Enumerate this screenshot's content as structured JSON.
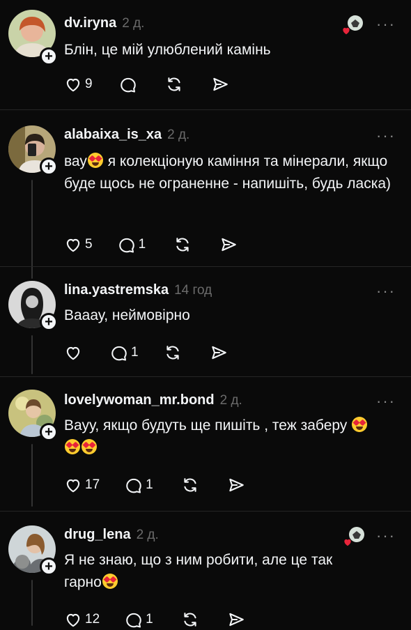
{
  "icons": {
    "like": "heart-outline-icon",
    "reply": "speech-bubble-icon",
    "repost": "repost-arrows-icon",
    "share": "send-arrow-icon",
    "more": "more-horizontal-icon",
    "follow": "plus-icon",
    "author_like": "author-reaction-icon"
  },
  "colors": {
    "background": "#0a0a0a",
    "text": "#f3f5f7",
    "muted": "#6b6b6b",
    "heart": "#e8243a"
  },
  "more_label": "···",
  "follow_label": "+",
  "posts": [
    {
      "username": "dv.iryna",
      "time": "2 д.",
      "text": "Блін, це мій улюблений камінь",
      "likes": "9",
      "replies": "",
      "author_liked": true
    },
    {
      "username": "alabaixa_is_xa",
      "time": "2 д.",
      "text_parts": [
        "вау",
        " я колекціоную каміння та мінерали, якщо буде щось не ограненне - напишіть, будь ласка)"
      ],
      "likes": "5",
      "replies": "1",
      "author_liked": false
    },
    {
      "username": "lina.yastremska",
      "time": "14 год",
      "text": "Вааау, неймовірно",
      "likes": "",
      "replies": "1",
      "author_liked": false
    },
    {
      "username": "lovelywoman_mr.bond",
      "time": "2 д.",
      "text_parts": [
        "Вауу, якщо будуть ще пишіть , теж заберу "
      ],
      "likes": "17",
      "replies": "1",
      "author_liked": false
    },
    {
      "username": "drug_lena",
      "time": "2 д.",
      "text_parts": [
        "Я не знаю, що з ним робити, але це так гарно"
      ],
      "likes": "12",
      "replies": "1",
      "author_liked": true
    }
  ]
}
